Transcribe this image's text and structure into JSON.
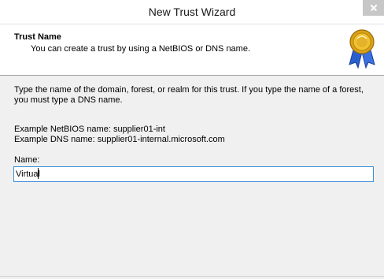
{
  "window": {
    "title": "New Trust Wizard"
  },
  "header": {
    "title": "Trust Name",
    "subtitle": "You can create a trust by using a NetBIOS or DNS name.",
    "icon": "award-ribbon-icon"
  },
  "body": {
    "description": "Type the name of the domain, forest, or realm for this trust. If you type the name of a forest, you must type a DNS name.",
    "example_netbios": "Example NetBIOS name: supplier01-int",
    "example_dns": "Example DNS name: supplier01-internal.microsoft.com",
    "name_label": "Name:",
    "name_value": "Virtual"
  },
  "colors": {
    "input_border": "#3c8fd8",
    "close_button": "#c7c7c7"
  }
}
